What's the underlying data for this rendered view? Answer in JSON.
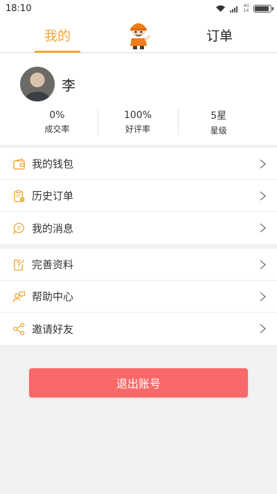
{
  "status_bar": {
    "time": "18:10",
    "network": "4G",
    "network_sub": "1X"
  },
  "colors": {
    "accent": "#f0a531",
    "logout": "#fb6869"
  },
  "nav": {
    "tabs": [
      {
        "label": "我的",
        "active": true
      },
      {
        "label": "订单",
        "active": false
      }
    ],
    "mascot_icon": "delivery-mascot-icon"
  },
  "profile": {
    "name": "李",
    "stats": [
      {
        "value": "0%",
        "label": "成交率"
      },
      {
        "value": "100%",
        "label": "好评率"
      },
      {
        "value": "5星",
        "label": "星级"
      }
    ]
  },
  "menu_group_1": [
    {
      "label": "我的钱包",
      "icon": "wallet-icon"
    },
    {
      "label": "历史订单",
      "icon": "history-order-icon"
    },
    {
      "label": "我的消息",
      "icon": "message-icon"
    }
  ],
  "menu_group_2": [
    {
      "label": "完善资料",
      "icon": "edit-profile-icon"
    },
    {
      "label": "帮助中心",
      "icon": "help-center-icon"
    },
    {
      "label": "邀请好友",
      "icon": "share-icon"
    }
  ],
  "logout_label": "退出账号"
}
